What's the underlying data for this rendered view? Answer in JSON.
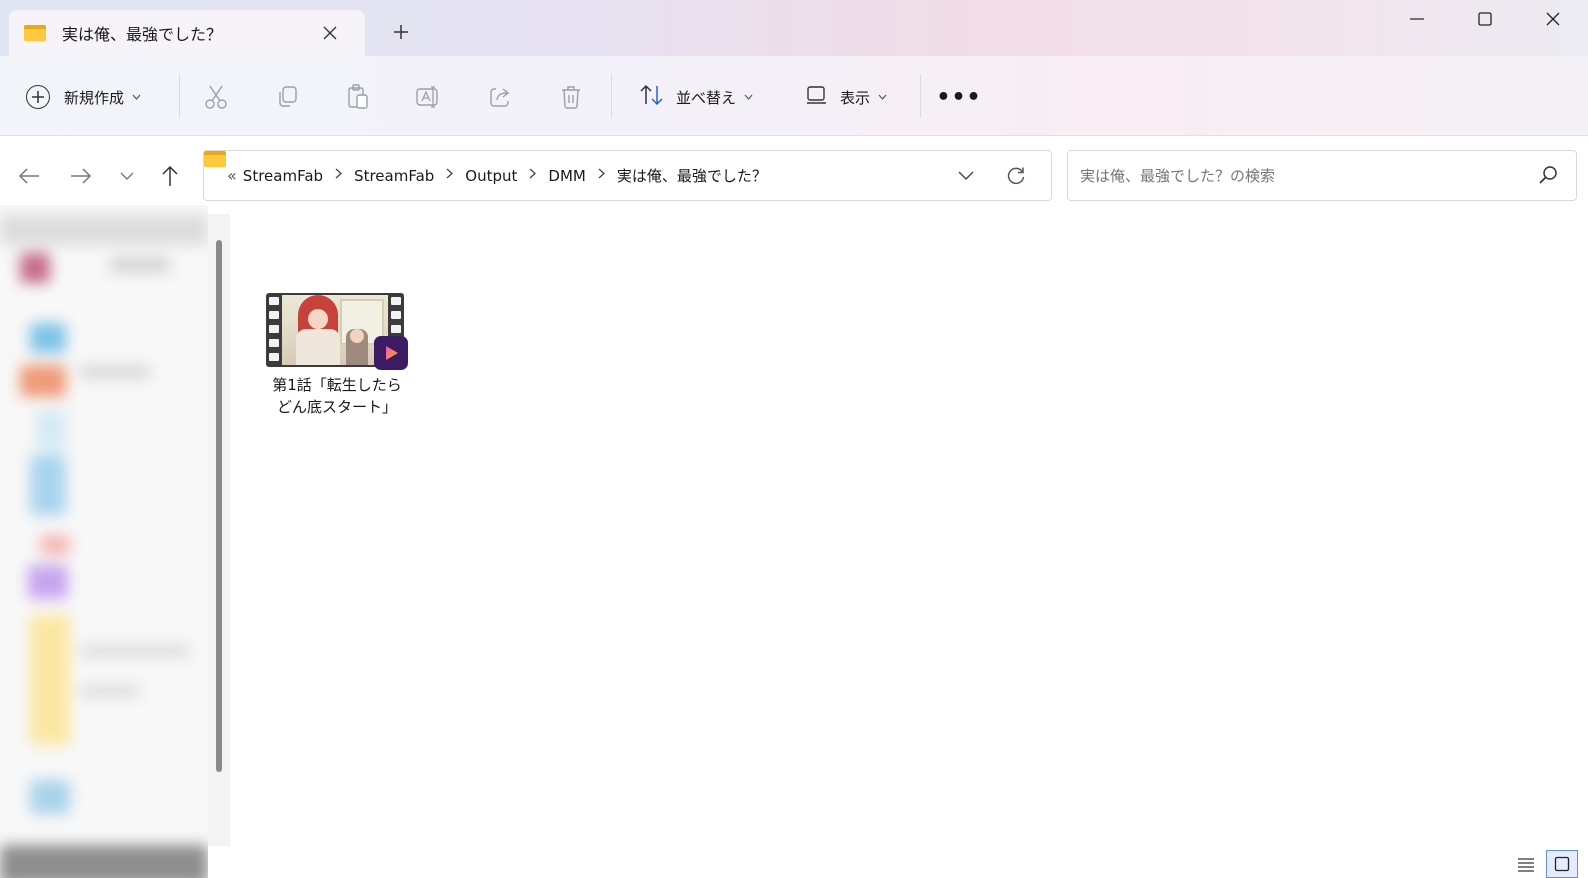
{
  "window": {
    "tab_title": "実は俺、最強でした？",
    "tab_close_icon": "close-icon",
    "new_tab_icon": "plus-icon",
    "controls": [
      "minimize-icon",
      "maximize-icon",
      "close-icon"
    ]
  },
  "toolbar": {
    "new_label": "新規作成",
    "sort_label": "並べ替え",
    "view_label": "表示",
    "more_label": "•••",
    "icons": [
      "cut-icon",
      "copy-icon",
      "paste-icon",
      "rename-icon",
      "share-icon",
      "delete-icon"
    ]
  },
  "address": {
    "overflow": "«",
    "crumbs": [
      "StreamFab",
      "StreamFab",
      "Output",
      "DMM",
      "実は俺、最強でした？"
    ]
  },
  "search": {
    "placeholder": "実は俺、最強でした？の検索"
  },
  "files": [
    {
      "name_line1": "第1話「転生したら",
      "name_line2": "どん底スタート」",
      "type": "video"
    }
  ],
  "colors": {
    "folder": "#ffc93e",
    "play_badge": "#3b1c63",
    "accent": "#6a8fd1"
  }
}
